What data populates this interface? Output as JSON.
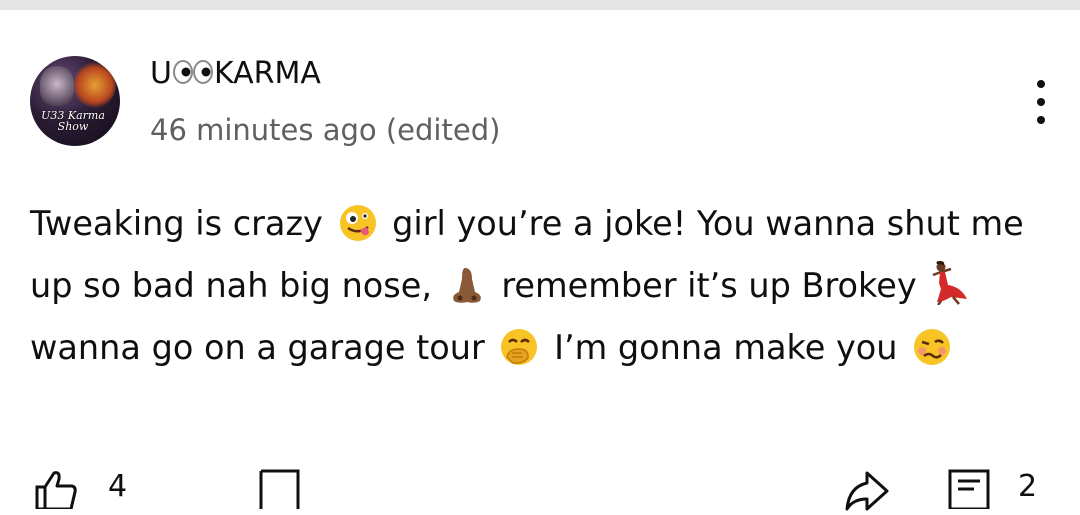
{
  "comment": {
    "author": {
      "name_prefix": "U",
      "name_suffix": "KARMA",
      "eyes_icon": "eyes-emoji-icon",
      "avatar_text": "U33 Karma Show"
    },
    "timestamp": "46 minutes ago (edited)",
    "body": {
      "seg1": "Tweaking is crazy",
      "emoji1": "zany-face-emoji",
      "seg2": "girl you’re a joke! You wanna shut me up so bad nah big nose,",
      "emoji2": "nose-emoji",
      "seg3": "remember it’s up Brokey",
      "emoji3": "dancing-woman-emoji",
      "seg4": "wanna go on a garage tour",
      "emoji4": "hand-over-mouth-emoji",
      "seg5": "I’m gonna make you",
      "emoji5": "woozy-face-emoji"
    },
    "actions": {
      "like_count": "4",
      "dislike_icon": "thumbs-down-icon",
      "share_icon": "share-icon",
      "replies_icon": "reply-icon",
      "reply_count": "2"
    }
  },
  "colors": {
    "text": "#0f0f0f",
    "secondary_text": "#606060",
    "divider": "#e5e5e5",
    "emoji_yellow": "#f7c325",
    "nose_skin": "#8a5a36",
    "dancer_dress": "#d42a2a"
  }
}
